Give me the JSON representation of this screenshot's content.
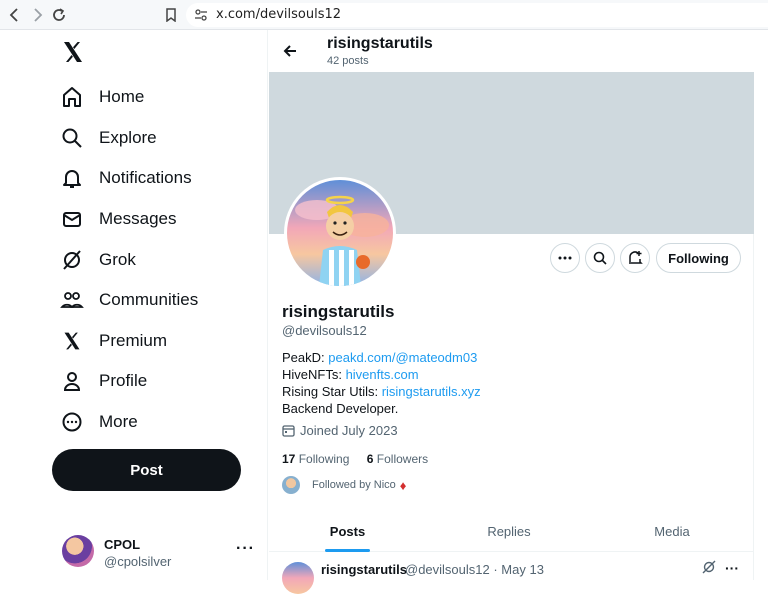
{
  "browser": {
    "url": "x.com/devilsouls12"
  },
  "sidebar": {
    "items": [
      {
        "label": "Home",
        "icon": "home-icon"
      },
      {
        "label": "Explore",
        "icon": "search-icon"
      },
      {
        "label": "Notifications",
        "icon": "bell-icon"
      },
      {
        "label": "Messages",
        "icon": "envelope-icon"
      },
      {
        "label": "Grok",
        "icon": "grok-icon"
      },
      {
        "label": "Communities",
        "icon": "people-icon"
      },
      {
        "label": "Premium",
        "icon": "x-logo-icon"
      },
      {
        "label": "Profile",
        "icon": "person-icon"
      },
      {
        "label": "More",
        "icon": "more-circle-icon"
      }
    ],
    "post_label": "Post",
    "account": {
      "name": "CPOL",
      "handle": "@cpolsilver",
      "more": "···"
    }
  },
  "header": {
    "name": "risingstarutils",
    "posts": "42 posts"
  },
  "profile": {
    "following_label": "Following",
    "name": "risingstarutils",
    "handle": "@devilsouls12",
    "bio": [
      {
        "prefix": "PeakD: ",
        "link": "peakd.com/@mateodm03"
      },
      {
        "prefix": "HiveNFTs: ",
        "link": "hivenfts.com"
      },
      {
        "prefix": "Rising Star Utils: ",
        "link": "risingstarutils.xyz"
      },
      {
        "prefix": "Backend Developer.",
        "link": ""
      }
    ],
    "joined": "Joined July 2023",
    "following_count": "17",
    "following_text": "Following",
    "followers_count": "6",
    "followers_text": "Followers",
    "followed_by": "Followed by Nico",
    "followed_by_emoji": "♦"
  },
  "tabs": [
    {
      "label": "Posts",
      "active": true
    },
    {
      "label": "Replies",
      "active": false
    },
    {
      "label": "Media",
      "active": false
    }
  ],
  "post": {
    "name": "risingstarutils",
    "meta": "@devilsouls12 · May 13"
  },
  "colors": {
    "accent": "#1d9bf0",
    "banner": "#cfd9de",
    "text": "#0f1419",
    "muted": "#536471"
  }
}
